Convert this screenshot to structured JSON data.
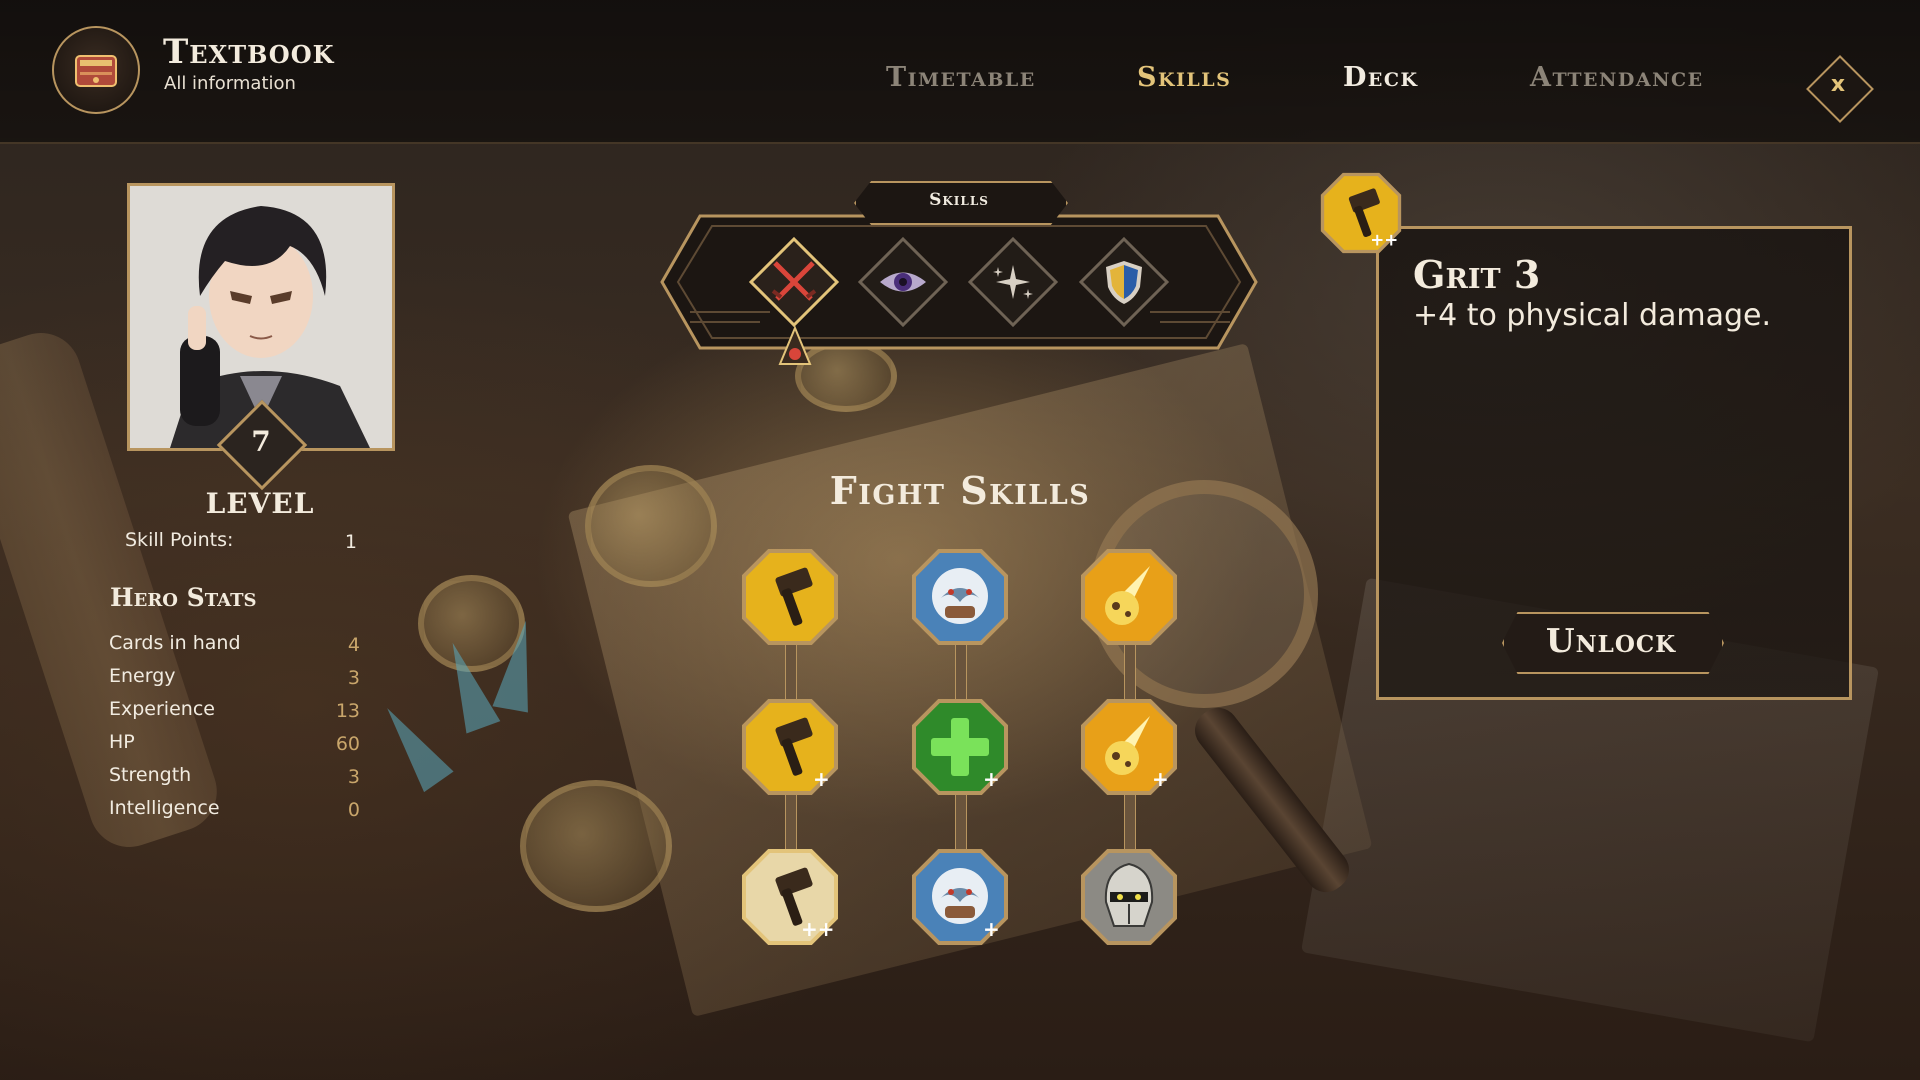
{
  "header": {
    "title": "Textbook",
    "subtitle": "All information",
    "icon": "book-icon",
    "tabs": [
      {
        "label": "Timetable",
        "state": "inactive"
      },
      {
        "label": "Skills",
        "state": "selected"
      },
      {
        "label": "Deck",
        "state": "hover"
      },
      {
        "label": "Attendance",
        "state": "inactive"
      }
    ],
    "close_label": "x"
  },
  "hero": {
    "level": "7",
    "level_label": "LEVEL",
    "skill_points_label": "Skill Points:",
    "skill_points_value": "1",
    "stats_title": "Hero Stats",
    "stats": [
      {
        "label": "Cards in hand",
        "value": "4"
      },
      {
        "label": "Energy",
        "value": "3"
      },
      {
        "label": "Experience",
        "value": "13"
      },
      {
        "label": "HP",
        "value": "60"
      },
      {
        "label": "Strength",
        "value": "3"
      },
      {
        "label": "Intelligence",
        "value": "0"
      }
    ]
  },
  "skill_categories": {
    "title": "Skills",
    "items": [
      {
        "icon": "crossed-swords-icon",
        "selected": true
      },
      {
        "icon": "eye-icon",
        "selected": false
      },
      {
        "icon": "sparkles-icon",
        "selected": false
      },
      {
        "icon": "shield-icon",
        "selected": false
      }
    ]
  },
  "fight_skills": {
    "title": "Fight Skills",
    "columns": [
      [
        {
          "icon": "hammer-icon",
          "upgrade": ""
        },
        {
          "icon": "hammer-icon",
          "upgrade": "+"
        },
        {
          "icon": "hammer-icon",
          "upgrade": "++"
        }
      ],
      [
        {
          "icon": "beast-claw-icon",
          "upgrade": ""
        },
        {
          "icon": "heal-cross-icon",
          "upgrade": "+"
        },
        {
          "icon": "beast-claw-icon",
          "upgrade": "+"
        }
      ],
      [
        {
          "icon": "flaming-rock-icon",
          "upgrade": ""
        },
        {
          "icon": "flaming-rock-icon",
          "upgrade": "+"
        },
        {
          "icon": "knight-helmet-icon",
          "upgrade": ""
        }
      ]
    ]
  },
  "selected_skill": {
    "icon": "hammer-icon",
    "upgrade": "++",
    "title": "Grit 3",
    "description": "+4 to physical damage.",
    "unlock_label": "Unlock"
  },
  "colors": {
    "gold": "#b8955f",
    "gold_text": "#e3c47a",
    "hammer_bg": "#e6b21c",
    "beast_bg": "#4a82b8",
    "heal_bg": "#2f8a2a",
    "fire_bg": "#e8a018",
    "helmet_bg": "#8c8a84"
  }
}
